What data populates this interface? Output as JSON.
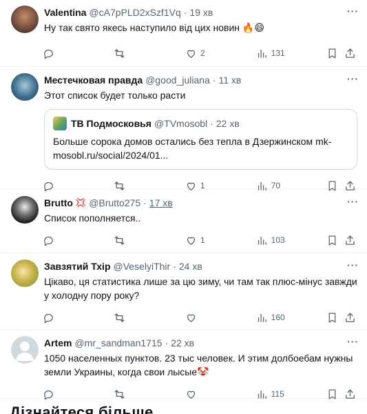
{
  "posts": [
    {
      "name": "Valentina",
      "handle": "@cA7pPLD2xSzf1Vq",
      "dot": "·",
      "time": "19 хв",
      "text": "Ну так свято якесь наступило від цих новин 🔥😄",
      "replies": "",
      "reposts": "",
      "likes": "2",
      "views": "131",
      "avatar_color": "#6b4a3a"
    },
    {
      "name": "Местечковая правда",
      "handle": "@good_juliana",
      "dot": "·",
      "time": "11 хв",
      "text": "Этот список будет только расти",
      "quote": {
        "name": "ТВ Подмосковья",
        "handle": "@TVmosobl",
        "dot": "·",
        "time": "22 хв",
        "text": "Больше сорока домов остались без тепла в Дзержинском  mk-mosobl.ru/social/2024/01..."
      },
      "replies": "",
      "reposts": "",
      "likes": "1",
      "views": "70",
      "avatar_color": "#3d6f8f"
    },
    {
      "name": "Brutto",
      "name_badge": "💢",
      "handle": "@Brutto275",
      "dot": "·",
      "time": "17 хв",
      "text": "Список пополняется..",
      "replies": "",
      "reposts": "",
      "likes": "1",
      "views": "103",
      "avatar_color": "#222222"
    },
    {
      "name": "Завзятий Тхір",
      "handle": "@VeselyiThir",
      "dot": "·",
      "time": "24 хв",
      "text": "Цікаво, ця статистика лише за цю зиму, чи там так плюс-мінус завжди у холодну пору року?",
      "replies": "",
      "reposts": "",
      "likes": "",
      "views": "160",
      "avatar_color": "#c9b24a"
    },
    {
      "name": "Artem",
      "handle": "@mr_sandman1715",
      "dot": "·",
      "time": "22 хв",
      "text": "1050 населенных пунктов. 23 тыс человек. И этим долбоебам нужны земли Украины, когда свои лысые🤡",
      "replies": "",
      "reposts": "",
      "likes": "",
      "views": "115",
      "avatar_color": "#cfd9de"
    }
  ],
  "more_label": "···",
  "footer_title": "Дізнайтеся більше"
}
